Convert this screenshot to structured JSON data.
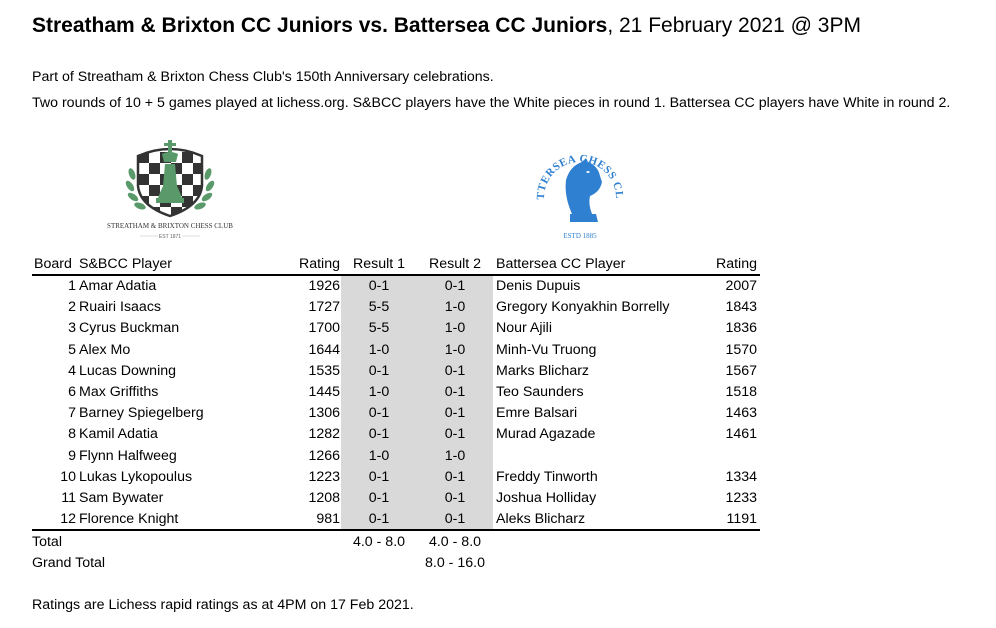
{
  "title": {
    "bold": "Streatham & Brixton CC Juniors vs. Battersea CC Juniors",
    "rest": ", 21 February 2021 @ 3PM"
  },
  "intro": [
    "Part of Streatham & Brixton Chess Club's 150th Anniversary celebrations.",
    "Two rounds of 10 + 5 games played at lichess.org. S&BCC players have the White pieces in round 1. Battersea CC players have White in round 2."
  ],
  "logos": {
    "sbcc": {
      "name": "STREATHAM & BRIXTON CHESS CLUB",
      "est": "EST 1871",
      "colors": {
        "green": "#5a9a6a",
        "dark": "#333333"
      }
    },
    "bcc": {
      "name": "BATTERSEA CHESS CLUB",
      "est": "ESTD 1885",
      "color": "#2f80d0"
    }
  },
  "table": {
    "headers": {
      "board": "Board",
      "player": "S&BCC Player",
      "rating": "Rating",
      "result1": "Result 1",
      "result2": "Result 2",
      "opponent": "Battersea CC Player",
      "opp_rating": "Rating"
    },
    "rows": [
      {
        "board": "1",
        "player": "Amar Adatia",
        "rating": "1926",
        "result1": "0-1",
        "result2": "0-1",
        "opponent": "Denis Dupuis",
        "opp_rating": "2007"
      },
      {
        "board": "2",
        "player": "Ruairi Isaacs",
        "rating": "1727",
        "result1": "5-5",
        "result2": "1-0",
        "opponent": "Gregory Konyakhin Borrelly",
        "opp_rating": "1843"
      },
      {
        "board": "3",
        "player": "Cyrus Buckman",
        "rating": "1700",
        "result1": "5-5",
        "result2": "1-0",
        "opponent": "Nour Ajili",
        "opp_rating": "1836"
      },
      {
        "board": "5",
        "player": "Alex Mo",
        "rating": "1644",
        "result1": "1-0",
        "result2": "1-0",
        "opponent": "Minh-Vu Truong",
        "opp_rating": "1570"
      },
      {
        "board": "4",
        "player": "Lucas Downing",
        "rating": "1535",
        "result1": "0-1",
        "result2": "0-1",
        "opponent": "Marks Blicharz",
        "opp_rating": "1567"
      },
      {
        "board": "6",
        "player": "Max Griffiths",
        "rating": "1445",
        "result1": "1-0",
        "result2": "0-1",
        "opponent": "Teo Saunders",
        "opp_rating": "1518"
      },
      {
        "board": "7",
        "player": "Barney Spiegelberg",
        "rating": "1306",
        "result1": "0-1",
        "result2": "0-1",
        "opponent": "Emre Balsari",
        "opp_rating": "1463"
      },
      {
        "board": "8",
        "player": "Kamil Adatia",
        "rating": "1282",
        "result1": "0-1",
        "result2": "0-1",
        "opponent": "Murad Agazade",
        "opp_rating": "1461"
      },
      {
        "board": "9",
        "player": "Flynn Halfweeg",
        "rating": "1266",
        "result1": "1-0",
        "result2": "1-0",
        "opponent": "",
        "opp_rating": ""
      },
      {
        "board": "10",
        "player": "Lukas Lykopoulus",
        "rating": "1223",
        "result1": "0-1",
        "result2": "0-1",
        "opponent": "Freddy Tinworth",
        "opp_rating": "1334"
      },
      {
        "board": "11",
        "player": "Sam Bywater",
        "rating": "1208",
        "result1": "0-1",
        "result2": "0-1",
        "opponent": "Joshua Holliday",
        "opp_rating": "1233"
      },
      {
        "board": "12",
        "player": "Florence Knight",
        "rating": "981",
        "result1": "0-1",
        "result2": "0-1",
        "opponent": "Aleks Blicharz",
        "opp_rating": "1191"
      }
    ],
    "total": {
      "label": "Total",
      "result1": "4.0 - 8.0",
      "result2": "4.0 - 8.0"
    },
    "grand_total": {
      "label": "Grand Total",
      "value": "8.0 - 16.0"
    },
    "shade_color": "#d9d9d9"
  },
  "footer": "Ratings are Lichess rapid ratings as at 4PM on 17 Feb 2021."
}
